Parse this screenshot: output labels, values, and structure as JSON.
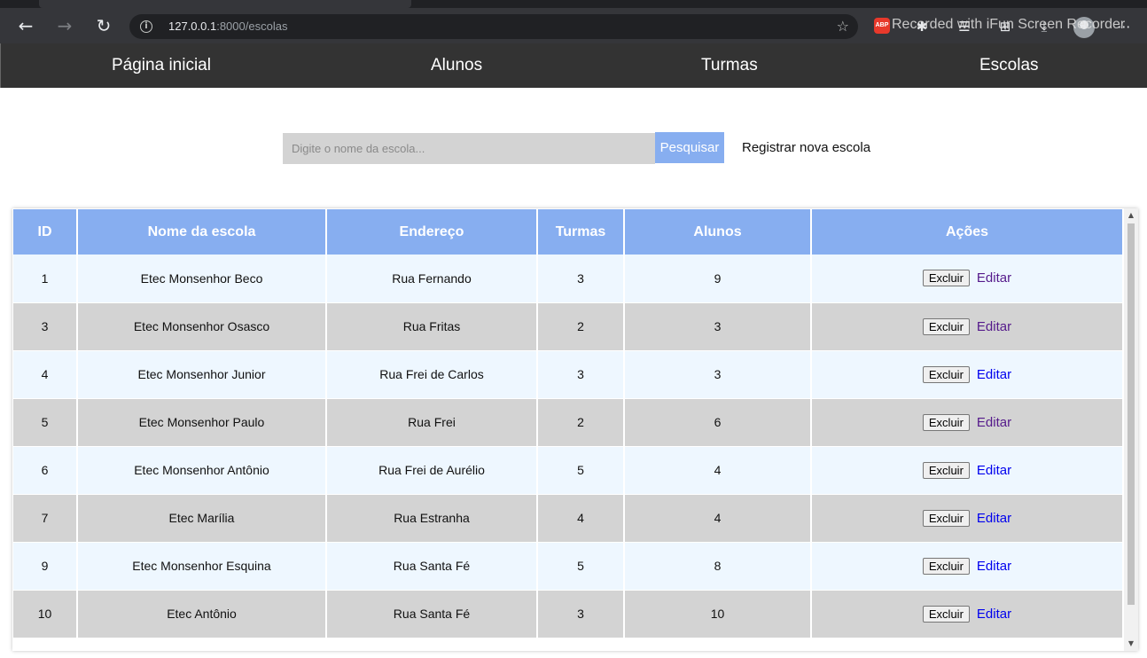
{
  "browser": {
    "url_host": "127.0.0.1",
    "url_rest": ":8000/escolas",
    "back_icon": "←",
    "forward_icon": "→",
    "reload_icon": "↻",
    "extensions": [
      {
        "name": "puzzle-icon",
        "glyph": "✱"
      },
      {
        "name": "reading-list-icon",
        "glyph": "☰"
      },
      {
        "name": "collections-icon",
        "glyph": "⊞"
      },
      {
        "name": "downloads-icon",
        "glyph": "⤓"
      }
    ],
    "abp_label": "ABP",
    "menu_icon": "⋯",
    "watermark": "Recorded with iFun Screen Recorder"
  },
  "nav": {
    "home": "Página inicial",
    "alunos": "Alunos",
    "turmas": "Turmas",
    "escolas": "Escolas"
  },
  "search": {
    "placeholder": "Digite o nome da escola...",
    "button_label": "Pesquisar",
    "register_label": "Registrar nova escola"
  },
  "table": {
    "headers": {
      "id": "ID",
      "nome": "Nome da escola",
      "endereco": "Endereço",
      "turmas": "Turmas",
      "alunos": "Alunos",
      "acoes": "Ações"
    },
    "delete_label": "Excluir",
    "edit_label": "Editar",
    "rows": [
      {
        "id": "1",
        "nome": "Etec Monsenhor Beco",
        "endereco": "Rua Fernando",
        "turmas": "3",
        "alunos": "9"
      },
      {
        "id": "3",
        "nome": "Etec Monsenhor Osasco",
        "endereco": "Rua Fritas",
        "turmas": "2",
        "alunos": "3"
      },
      {
        "id": "4",
        "nome": "Etec Monsenhor Junior",
        "endereco": "Rua Frei de Carlos",
        "turmas": "3",
        "alunos": "3"
      },
      {
        "id": "5",
        "nome": "Etec Monsenhor Paulo",
        "endereco": "Rua Frei",
        "turmas": "2",
        "alunos": "6"
      },
      {
        "id": "6",
        "nome": "Etec Monsenhor Antônio",
        "endereco": "Rua Frei de Aurélio",
        "turmas": "5",
        "alunos": "4"
      },
      {
        "id": "7",
        "nome": "Etec Marília",
        "endereco": "Rua Estranha",
        "turmas": "4",
        "alunos": "4"
      },
      {
        "id": "9",
        "nome": "Etec Monsenhor Esquina",
        "endereco": "Rua Santa Fé",
        "turmas": "5",
        "alunos": "8"
      },
      {
        "id": "10",
        "nome": "Etec Antônio",
        "endereco": "Rua Santa Fé",
        "turmas": "3",
        "alunos": "10"
      }
    ]
  },
  "colors": {
    "header_bg": "#87aef0",
    "nav_bg": "#333333",
    "row_odd": "#eef7ff",
    "row_even": "#d3d3d3"
  }
}
